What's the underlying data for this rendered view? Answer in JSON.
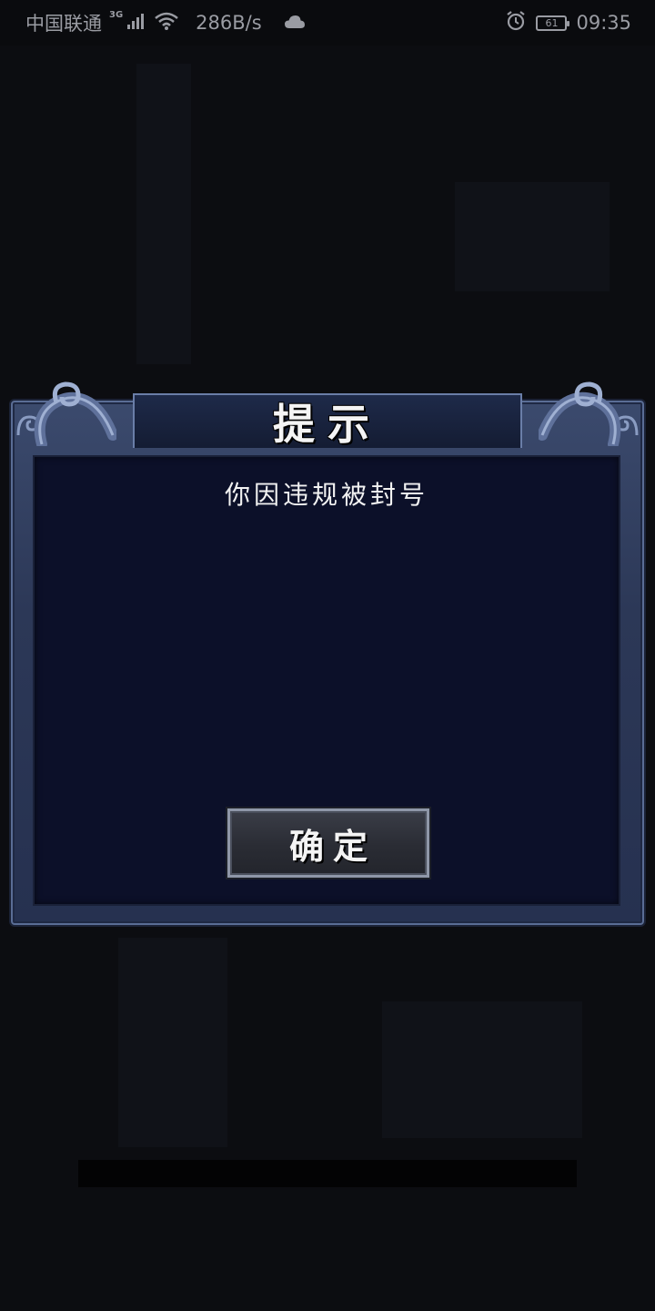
{
  "status_bar": {
    "carrier": "中国联通",
    "network_type": "3G",
    "speed": "286B/s",
    "battery": "61",
    "time": "09:35"
  },
  "dialog": {
    "title": "提示",
    "message": "你因违规被封号",
    "confirm_label": "确定"
  },
  "colors": {
    "background": "#0c0d11",
    "frame": "#2c3857",
    "body": "#0c1029",
    "button": "#2a2c34",
    "text": "#f2f2f2"
  },
  "icons": [
    "signal-icon",
    "wifi-icon",
    "cloud-icon",
    "alarm-icon",
    "battery-icon"
  ]
}
